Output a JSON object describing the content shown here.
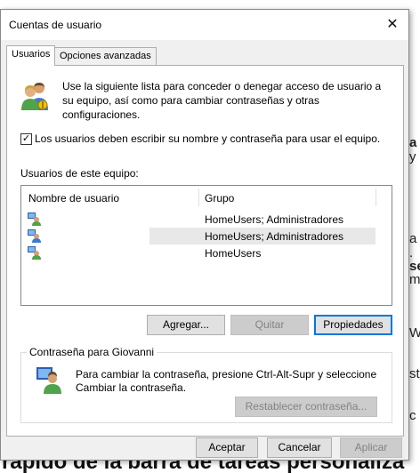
{
  "dialog": {
    "title": "Cuentas de usuario",
    "close_glyph": "✕"
  },
  "tabs": [
    {
      "label": "Usuarios",
      "active": true
    },
    {
      "label": "Opciones avanzadas",
      "active": false
    }
  ],
  "intro_text": "Use la siguiente lista para conceder o denegar acceso de usuario a su equipo, así como para cambiar contraseñas y otras configuraciones.",
  "require_login": {
    "checked": true,
    "label": "Los usuarios deben escribir su nombre y contraseña para usar el equipo."
  },
  "users_list": {
    "label": "Usuarios de este equipo:",
    "columns": [
      "Nombre de usuario",
      "Grupo"
    ],
    "rows": [
      {
        "name": "",
        "group": "HomeUsers; Administradores",
        "selected": false
      },
      {
        "name": "",
        "group": "HomeUsers; Administradores",
        "selected": true
      },
      {
        "name": "",
        "group": "HomeUsers",
        "selected": false
      }
    ]
  },
  "list_buttons": {
    "add": "Agregar...",
    "remove": "Quitar",
    "properties": "Propiedades"
  },
  "password_group": {
    "title": "Contraseña para Giovanni",
    "text": "Para cambiar la contraseña, presione Ctrl-Alt-Supr y seleccione Cambiar la contraseña.",
    "reset_button": "Restablecer contraseña..."
  },
  "footer_buttons": {
    "ok": "Aceptar",
    "cancel": "Cancelar",
    "apply": "Aplicar"
  },
  "background": {
    "fragments": [
      "a",
      "y",
      "a",
      ".",
      "se",
      "ma",
      "Wi",
      "st",
      "c"
    ],
    "heading": "rápido de la barra de tareas personaliza"
  }
}
